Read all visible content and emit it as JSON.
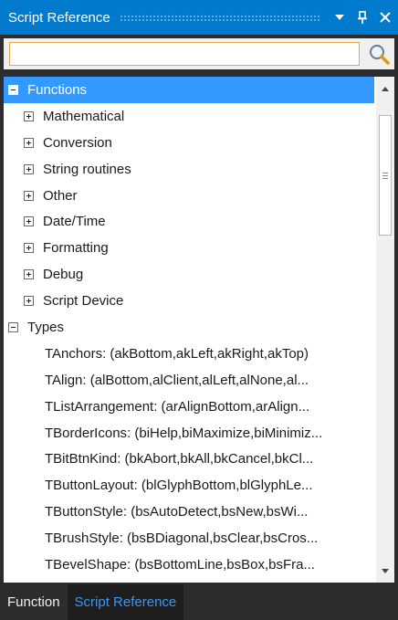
{
  "titlebar": {
    "title": "Script Reference",
    "dropdown_icon": "triangle-down-icon",
    "pin_icon": "pin-icon",
    "close_icon": "close-icon"
  },
  "search": {
    "value": "",
    "placeholder": "",
    "icon": "magnifier-icon"
  },
  "tree": {
    "functions": {
      "label": "Functions",
      "expanded": true,
      "children": [
        "Mathematical",
        "Conversion",
        "String routines",
        "Other",
        "Date/Time",
        "Formatting",
        "Debug",
        "Script Device"
      ]
    },
    "types": {
      "label": "Types",
      "expanded": true,
      "children": [
        "TAnchors: (akBottom,akLeft,akRight,akTop)",
        "TAlign: (alBottom,alClient,alLeft,alNone,al...",
        "TListArrangement: (arAlignBottom,arAlign...",
        "TBorderIcons: (biHelp,biMaximize,biMinimiz...",
        "TBitBtnKind: (bkAbort,bkAll,bkCancel,bkCl...",
        "TButtonLayout: (blGlyphBottom,blGlyphLe...",
        "TButtonStyle: (bsAutoDetect,bsNew,bsWi...",
        "TBrushStyle: (bsBDiagonal,bsClear,bsCros...",
        "TBevelShape: (bsBottomLine,bsBox,bsFra..."
      ]
    }
  },
  "tabs": [
    {
      "label": "Function",
      "active": false
    },
    {
      "label": "Script Reference",
      "active": true
    }
  ],
  "colors": {
    "accent": "#007acc",
    "selection": "#3399ff",
    "panel_bg": "#2d2d30",
    "search_border": "#e0a94a"
  }
}
